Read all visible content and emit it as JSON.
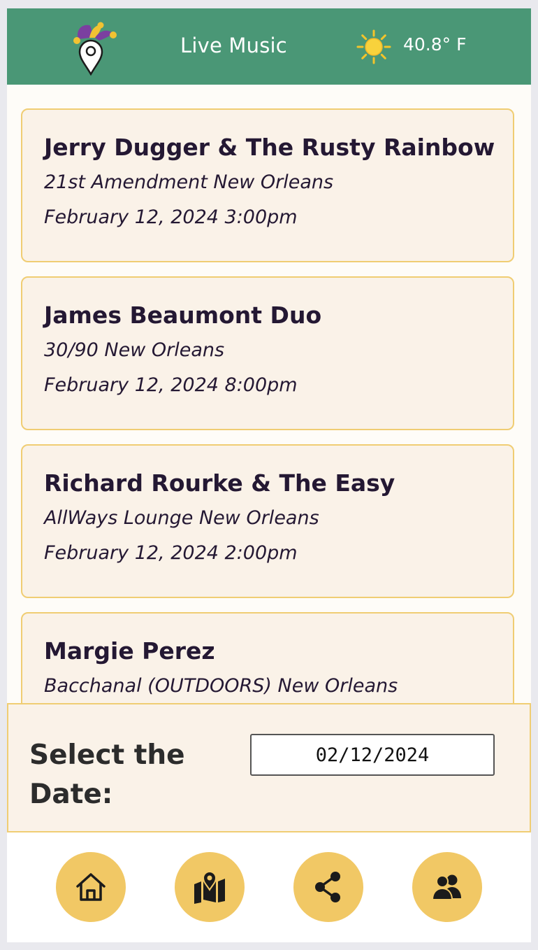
{
  "header": {
    "title": "Live Music",
    "logo_icon": "jester-pin-icon",
    "weather_icon": "sun-icon",
    "temperature": "40.8° F"
  },
  "events": [
    {
      "band": "Jerry Dugger & The Rusty Rainbow",
      "venue": "21st Amendment New Orleans",
      "datetime": "February 12, 2024 3:00pm"
    },
    {
      "band": "James Beaumont Duo",
      "venue": "30/90 New Orleans",
      "datetime": "February 12, 2024 8:00pm"
    },
    {
      "band": "Richard Rourke & The Easy",
      "venue": "AllWays Lounge New Orleans",
      "datetime": "February 12, 2024 2:00pm"
    },
    {
      "band": "Margie Perez",
      "venue": "Bacchanal (OUTDOORS) New Orleans",
      "datetime": ""
    }
  ],
  "date_picker": {
    "label": "Select the Date:",
    "value": "02/12/2024"
  },
  "nav": [
    {
      "icon": "home-icon"
    },
    {
      "icon": "map-pin-icon"
    },
    {
      "icon": "share-icon"
    },
    {
      "icon": "people-icon"
    }
  ],
  "colors": {
    "header_bg": "#4a9776",
    "card_bg": "#faf2e8",
    "card_border": "#f0cd73",
    "nav_button": "#f1c865",
    "text_dark": "#241833"
  }
}
